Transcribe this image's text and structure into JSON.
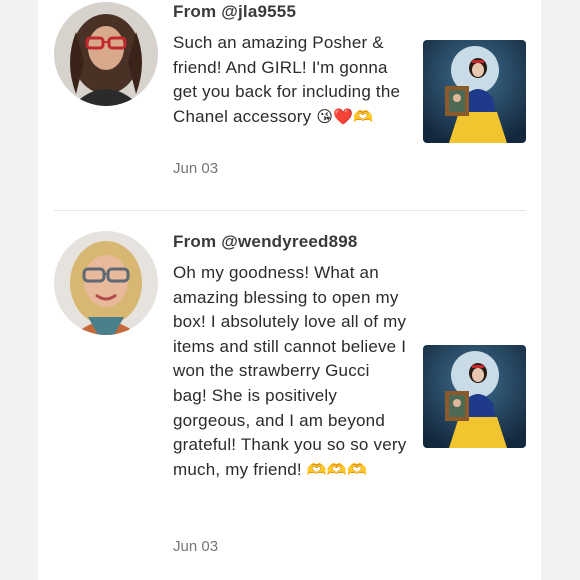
{
  "entries": [
    {
      "from": "From @jla9555",
      "message": "Such an amazing Posher & friend! And GIRL! I'm gonna get you back for including the Chanel accessory",
      "emoji": "😘❤️🫶",
      "date": "Jun 03"
    },
    {
      "from": "From @wendyreed898",
      "message": "Oh my goodness! What an amazing blessing to open my box! I absolutely love all of my items and still cannot believe I won the strawberry Gucci bag! She is positively gorgeous, and I am beyond grateful! Thank you so so very much, my friend!",
      "emoji": "🫶🫶🫶",
      "date": "Jun 03"
    }
  ],
  "icons": {
    "avatar_1": "user-avatar-dark-hair-red-glasses",
    "avatar_2": "user-avatar-blonde-gray-glasses",
    "thumb": "snow-white-moon-portrait-image"
  },
  "colors": {
    "background": "#f2f2f2",
    "card": "#ffffff",
    "thumb_bg": "#1e3d5c",
    "moon": "#c9dbe6"
  }
}
